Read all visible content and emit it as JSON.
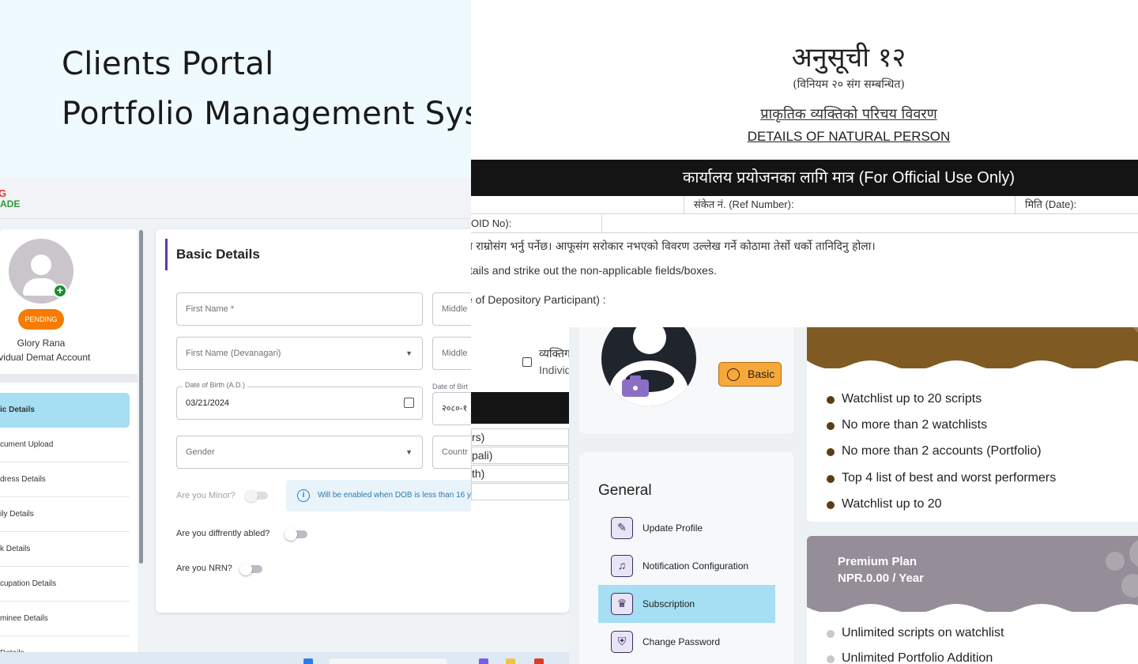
{
  "hero": {
    "line1": "Clients Portal",
    "line2": "Portfolio Management System"
  },
  "demat_app": {
    "logo_top": "G",
    "logo_bottom": "ADE",
    "profile": {
      "status_badge": "PENDING",
      "name": "Glory Rana",
      "account_type": "ividual Demat Account"
    },
    "sidebar_items": [
      "ic Details",
      "cument Upload",
      "dress Details",
      "ily Details",
      "k Details",
      "cupation Details",
      "minee Details",
      "Details"
    ],
    "form": {
      "heading": "Basic Details",
      "first_name_placeholder": "First Name *",
      "middle_name_placeholder": "Middle",
      "first_name_dev_placeholder": "First Name (Devanagari)",
      "middle_name_dev_placeholder": "Middle",
      "dob_ad_label": "Date of Birth (A.D.)",
      "dob_ad_value": "03/21/2024",
      "dob_bs_label": "Date of Birt",
      "dob_bs_value": "२०८०-१",
      "gender_placeholder": "Gender",
      "country_placeholder": "Countr",
      "minor_label": "Are you Minor?",
      "minor_info": "Will be enabled when DOB is less than 16 y",
      "differently_abled_label": "Are you diffrently abled?",
      "nrn_label": "Are you NRN?"
    }
  },
  "nepali_form": {
    "title": "अनुसूची १२",
    "rule": "(विनियम २० संग सम्बन्धित)",
    "subtitle_np": "प्राकृतिक व्यक्तिको परिचय विवरण",
    "subtitle_en": "DETAILS OF NATURAL PERSON",
    "official_bar": "कार्यालय प्रयोजनका लागि मात्र (For Official Use Only)",
    "ref_number": "संकेत नं. (Ref Number):",
    "date": "मिति (Date):",
    "boid": "OID No):",
    "instruction_np": "ा राम्रोसंग भर्नु पर्नेछ। आफूसंग सरोकार नभएको विवरण उल्लेख गर्ने कोठामा तेर्सो धर्को तानिदिनु होला।",
    "instruction_en": "tails and strike out the non-applicable fields/boxes.",
    "dp_name": "e of Depository Participant) :",
    "fragment_np": "व्यक्तिग",
    "fragment_en": "Individ",
    "fragment_rows": [
      "rs)",
      "pali)",
      "th)",
      ""
    ]
  },
  "settings": {
    "plan_badge": "Basic",
    "general_title": "General",
    "menu": [
      {
        "label": "Update Profile",
        "icon": "pencil-icon"
      },
      {
        "label": "Notification Configuration",
        "icon": "bell-icon"
      },
      {
        "label": "Subscription",
        "icon": "crown-icon"
      },
      {
        "label": "Change Password",
        "icon": "shield-lock-icon"
      }
    ],
    "active_menu": "Subscription",
    "basic_features": [
      "Watchlist up to 20 scripts",
      "No more than 2 watchlists",
      "No more than 2 accounts (Portfolio)",
      "Top 4 list of best and worst performers",
      "Watchlist up to 20"
    ],
    "premium": {
      "name": "Premium Plan",
      "price": "NPR.0.00 / Year",
      "features": [
        "Unlimited scripts on watchlist",
        "Unlimited Portfolio Addition"
      ]
    }
  },
  "colors": {
    "hero_bg": "#eefafe",
    "pending": "#f57c00",
    "active_item": "#a6def3",
    "basic_band": "#7f5a22",
    "premium_band": "#958e99",
    "basic_badge": "#f6a83a"
  }
}
